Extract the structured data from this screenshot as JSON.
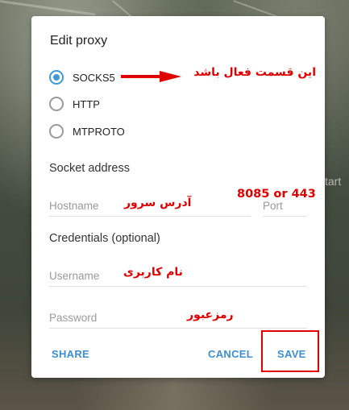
{
  "background": {
    "partial_text": "tart"
  },
  "dialog": {
    "title": "Edit proxy",
    "proxy_types": [
      {
        "label": "SOCKS5",
        "selected": true
      },
      {
        "label": "HTTP",
        "selected": false
      },
      {
        "label": "MTPROTO",
        "selected": false
      }
    ],
    "socket_section_title": "Socket address",
    "hostname": {
      "value": "",
      "placeholder": "Hostname"
    },
    "port": {
      "value": "",
      "placeholder": "Port"
    },
    "credentials_section_title": "Credentials (optional)",
    "username": {
      "value": "",
      "placeholder": "Username"
    },
    "password": {
      "value": "",
      "placeholder": "Password"
    },
    "buttons": {
      "share": "SHARE",
      "cancel": "CANCEL",
      "save": "SAVE"
    }
  },
  "annotations": {
    "socks5_note": "این قسمت فعال باشد",
    "hostname_note": "آدرس سرور",
    "port_note": "8085 or 443",
    "username_note": "نام کاربری",
    "password_note": "رمزعبور",
    "accent_color": "#e00000"
  },
  "colors": {
    "accent": "#3d9ad6",
    "button_text": "#3d8fd1"
  }
}
